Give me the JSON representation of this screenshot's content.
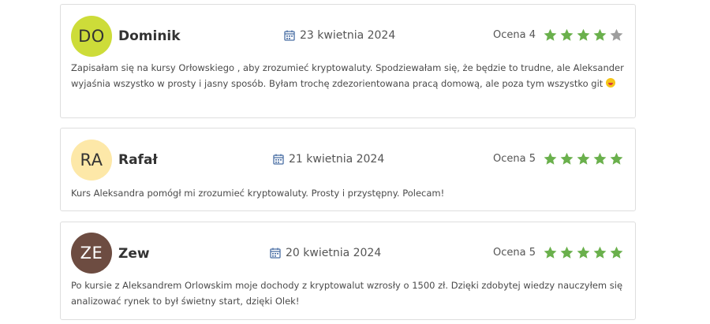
{
  "reviews": [
    {
      "initials": "DO",
      "name": "Dominik",
      "date": "23 kwietnia 2024",
      "rating_label": "Ocena 4",
      "rating": 4,
      "avatar_color": "#cddc39",
      "avatar_text_color": "#333333",
      "text": "Zapisałam się na kursy Orłowskiego , aby zrozumieć kryptowaluty. Spodziewałam się, że będzie to trudne, ale Aleksander wyjaśnia wszystko w prosty i jasny sposób. Byłam trochę zdezorientowana pracą domową, ale poza tym wszystko git",
      "emoji": "grinning-face-with-tongue"
    },
    {
      "initials": "RA",
      "name": "Rafał",
      "date": "21 kwietnia 2024",
      "rating_label": "Ocena 5",
      "rating": 5,
      "avatar_color": "#fde8a8",
      "avatar_text_color": "#333333",
      "text": "Kurs Aleksandra pomógł mi zrozumieć kryptowaluty. Prosty i przystępny. Polecam!"
    },
    {
      "initials": "ZE",
      "name": "Zew",
      "date": "20 kwietnia 2024",
      "rating_label": "Ocena 5",
      "rating": 5,
      "avatar_color": "#6d4c41",
      "avatar_text_color": "#ffffff",
      "text": "Po kursie z Aleksandrem Orlowskim moje dochody z kryptowalut wzrosły o 1500 zł. Dzięki zdobytej wiedzy nauczyłem się analizować rynek to był świetny start, dzięki Olek!"
    }
  ],
  "colors": {
    "star_filled": "#6ab04c",
    "star_empty": "#9e9e9e",
    "calendar_icon": "#4a6fa5",
    "card_border": "#dedede"
  }
}
